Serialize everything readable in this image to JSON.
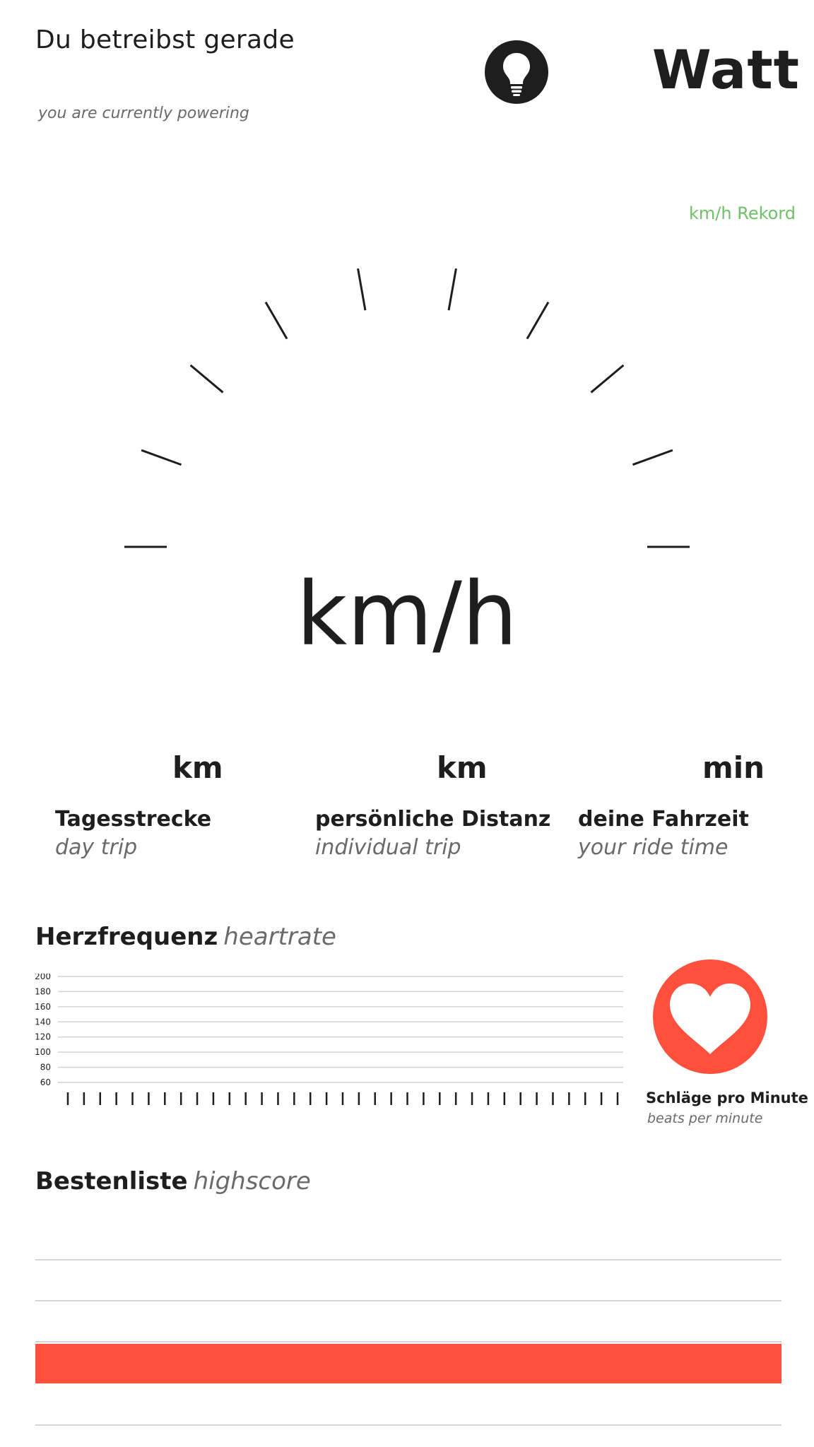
{
  "header": {
    "powering_de": "Du betreibst gerade",
    "powering_en": "you are currently powering",
    "power_icon": "lightbulb-icon",
    "power_unit": "Watt"
  },
  "speedometer": {
    "record_label": "km/h Rekord",
    "unit": "km/h"
  },
  "stats": [
    {
      "unit": "km",
      "label_de": "Tagesstrecke",
      "label_en": "day trip"
    },
    {
      "unit": "km",
      "label_de": "persönliche Distanz",
      "label_en": "individual trip"
    },
    {
      "unit": "min",
      "label_de": "deine Fahrzeit",
      "label_en": "your ride time"
    }
  ],
  "heartrate": {
    "title_de": "Herzfrequenz",
    "title_en": "heartrate",
    "icon": "heart-icon",
    "bpm_de": "Schläge pro Minute",
    "bpm_en": "beats per minute"
  },
  "chart_data": {
    "type": "line",
    "title": "",
    "xlabel": "",
    "ylabel": "",
    "yticks": [
      200,
      180,
      160,
      140,
      120,
      100,
      80,
      60
    ],
    "ylim": [
      60,
      200
    ],
    "x_tick_count": 35,
    "grid": true,
    "series": []
  },
  "highscore": {
    "title_de": "Bestenliste",
    "title_en": "highscore",
    "rows": [
      "",
      "",
      "",
      "",
      ""
    ],
    "highlighted_row": 3
  },
  "colors": {
    "accent": "#ff4f3d",
    "record": "#6ec167",
    "text": "#1e1e1e",
    "muted": "#6a6a6a",
    "gridline": "#d4d4d4"
  }
}
